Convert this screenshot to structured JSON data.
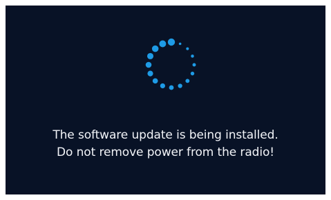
{
  "screen": {
    "background": "#081226",
    "message_line_1": "The software update is being installed.",
    "message_line_2": "Do not remove power from the radio!"
  },
  "spinner": {
    "icon": "loading-spinner-icon",
    "color": "#1e9be6",
    "dot_count": 16
  }
}
